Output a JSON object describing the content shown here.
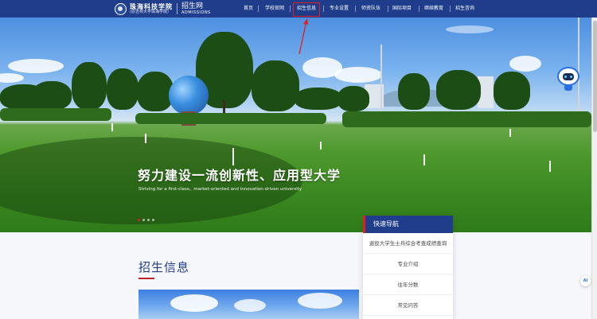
{
  "header": {
    "school_name": "珠海科技学院",
    "school_sub": "(原吉林大学珠海学院)",
    "site_name": "招生网",
    "site_name_en": "ADMISSIONS"
  },
  "nav": {
    "items": [
      {
        "label": "首页"
      },
      {
        "label": "学校官网"
      },
      {
        "label": "招生信息"
      },
      {
        "label": "专业设置"
      },
      {
        "label": "师资队伍"
      },
      {
        "label": "国际项目"
      },
      {
        "label": "继续教育"
      },
      {
        "label": "招生咨询"
      }
    ],
    "active_index": 2
  },
  "hero": {
    "title": "努力建设一流创新性、应用型大学",
    "subtitle": "Striving for a first-class、market-oriented and innovation-driven university",
    "slide_count": 4,
    "active_slide": 0
  },
  "section": {
    "title": "招生信息"
  },
  "quick_nav": {
    "title": "快速导航",
    "items": [
      {
        "label": "退役大学生士兵综合考查成绩查询"
      },
      {
        "label": "专业介绍"
      },
      {
        "label": "往年分数"
      },
      {
        "label": "常见问答"
      }
    ]
  },
  "ai_badge": "AI",
  "colors": {
    "header_bg": "#1f3d8a",
    "accent_red": "#e02020",
    "section_title": "#1f3d8a"
  },
  "icons": {
    "logo": "school-seal-icon",
    "assistant": "robot-assistant-icon",
    "annotation": "red-arrow-icon"
  }
}
